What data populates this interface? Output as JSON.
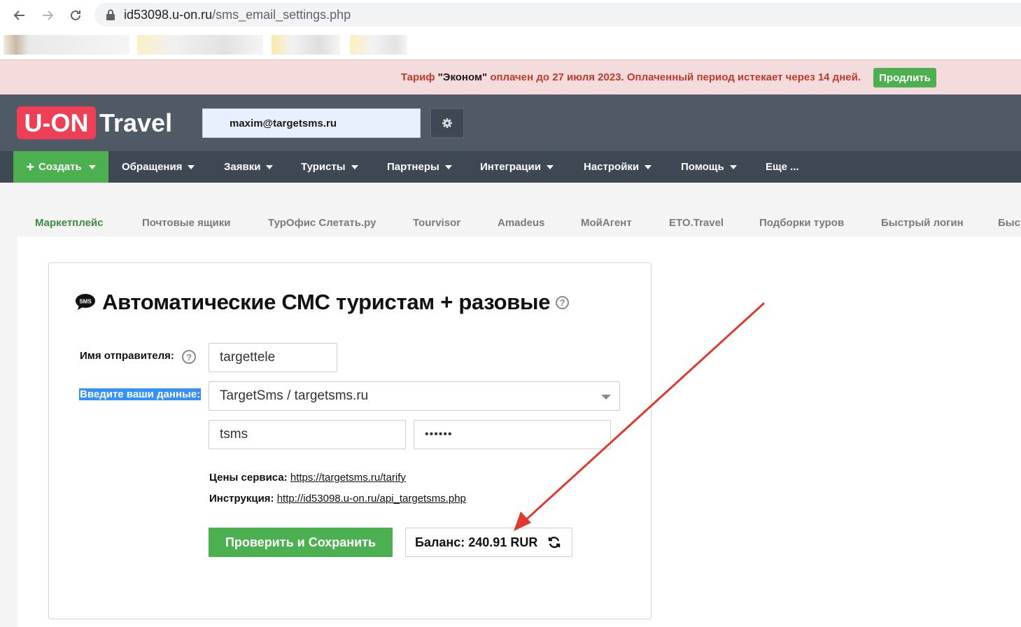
{
  "browser": {
    "url_host": "id53098.u-on.ru",
    "url_path": "/sms_email_settings.php"
  },
  "banner": {
    "prefix": "Тариф ",
    "plan": "\"Эконом\"",
    "suffix": " оплачен до 27 июля 2023.  Оплаченный период истекает через 14 дней.",
    "renew_label": "Продлить"
  },
  "header": {
    "logo_part1": "U-ON",
    "logo_part2": "Travel",
    "user_email": "maxim@targetsms.ru"
  },
  "mainnav": {
    "create_label": "Создать",
    "items": [
      {
        "label": "Обращения"
      },
      {
        "label": "Заявки"
      },
      {
        "label": "Туристы"
      },
      {
        "label": "Партнеры"
      },
      {
        "label": "Интеграции"
      },
      {
        "label": "Настройки"
      },
      {
        "label": "Помощь"
      },
      {
        "label": "Еще ..."
      }
    ]
  },
  "subtabs": [
    {
      "label": "Маркетплейс"
    },
    {
      "label": "Почтовые ящики"
    },
    {
      "label": "ТурОфис Слетать.ру"
    },
    {
      "label": "Tourvisor"
    },
    {
      "label": "Amadeus"
    },
    {
      "label": "МойАгент"
    },
    {
      "label": "ETO.Travel"
    },
    {
      "label": "Подборки туров"
    },
    {
      "label": "Быстрый логин"
    },
    {
      "label": "Быст"
    }
  ],
  "card": {
    "sms_badge": "SMS",
    "title": "Автоматические СМС туристам + разовые",
    "sender_label": "Имя отправителя:",
    "sender_value": "targettele",
    "data_label": "Введите ваши данные:",
    "provider_value": "TargetSms / targetsms.ru",
    "login_value": "tsms",
    "password_value": "••••••",
    "prices_label": "Цены сервиса:",
    "prices_link": "https://targetsms.ru/tarify",
    "instr_label": "Инструкция:",
    "instr_link": "http://id53098.u-on.ru/api_targetsms.php",
    "save_label": "Проверить и Сохранить",
    "balance_text": "Баланс: 240.91 RUR"
  },
  "colors": {
    "accent_green": "#4caf50",
    "header_bg": "#4f5a66",
    "logo_red": "#ef3f56",
    "annotation_arrow": "#e0392f"
  }
}
